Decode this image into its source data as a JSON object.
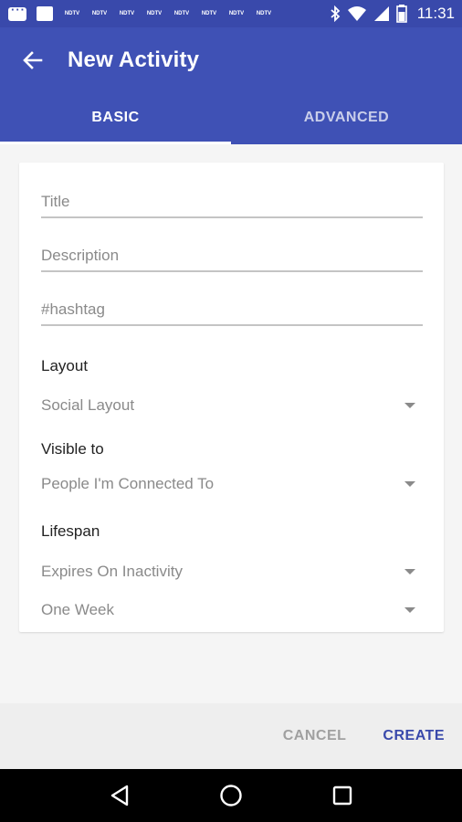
{
  "status_bar": {
    "time": "11:31",
    "notification_labels": [
      "NDTV",
      "NDTV",
      "NDTV",
      "NDTV",
      "NDTV",
      "NDTV",
      "NDTV",
      "NDTV"
    ]
  },
  "header": {
    "title": "New Activity"
  },
  "tabs": [
    {
      "label": "BASIC",
      "active": true
    },
    {
      "label": "ADVANCED",
      "active": false
    }
  ],
  "form": {
    "title_placeholder": "Title",
    "description_placeholder": "Description",
    "hashtag_placeholder": "#hashtag",
    "layout_label": "Layout",
    "layout_value": "Social Layout",
    "visible_label": "Visible to",
    "visible_value": "People I'm Connected To",
    "lifespan_label": "Lifespan",
    "lifespan_mode_value": "Expires On Inactivity",
    "lifespan_duration_value": "One Week"
  },
  "actions": {
    "cancel_label": "CANCEL",
    "create_label": "CREATE"
  },
  "colors": {
    "primary": "#3f51b5",
    "primary_dark": "#3949ab",
    "accent_text": "#3949ab"
  }
}
